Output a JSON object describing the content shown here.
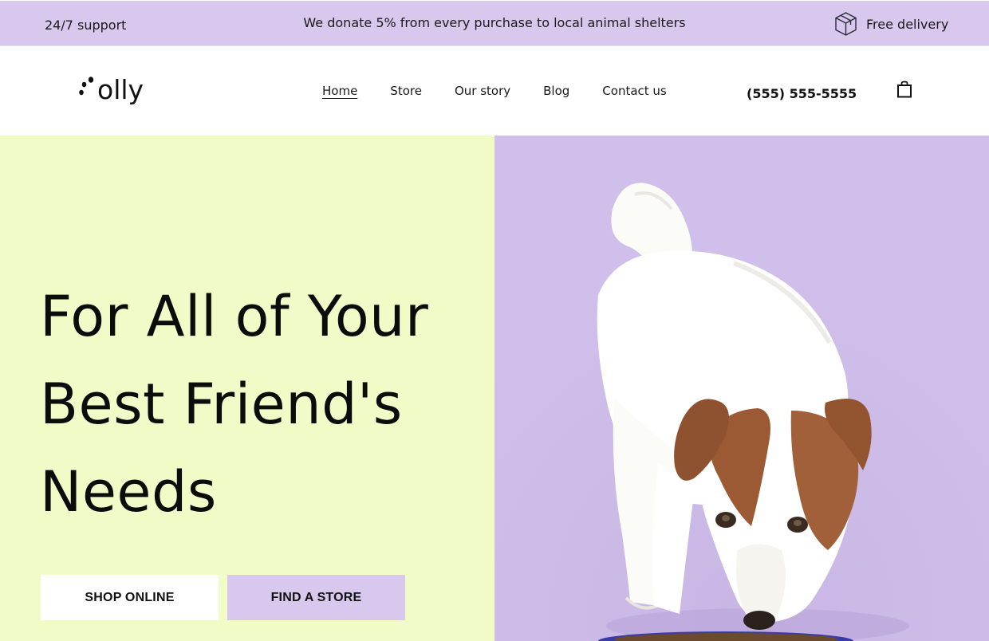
{
  "topbar": {
    "support": "24/7 support",
    "donate": "We donate 5% from every purchase to local animal shelters",
    "delivery": "Free delivery",
    "delivery_icon": "box-icon"
  },
  "header": {
    "logo_text": "olly",
    "nav": [
      {
        "label": "Home",
        "active": true
      },
      {
        "label": "Store",
        "active": false
      },
      {
        "label": "Our story",
        "active": false
      },
      {
        "label": "Blog",
        "active": false
      },
      {
        "label": "Contact us",
        "active": false
      }
    ],
    "phone": "(555) 555-5555",
    "cart_icon": "shopping-bag-icon"
  },
  "hero": {
    "title_lines": [
      "For All of Your",
      "Best Friend's",
      "Needs"
    ],
    "shop_button": "SHOP ONLINE",
    "find_button": "FIND A STORE",
    "image": "dog-eating-photo"
  },
  "colors": {
    "lavender": "#d8c8ee",
    "hero_left_bg": "#f0fbc8",
    "hero_right_bg": "#cfbde9",
    "text": "#111111"
  }
}
